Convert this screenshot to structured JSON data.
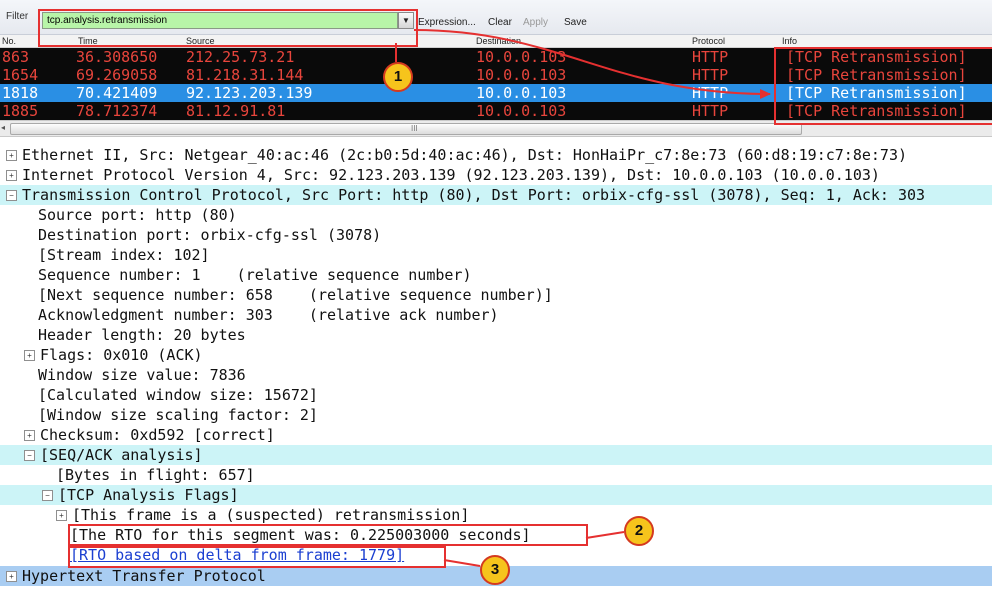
{
  "toolbar": {
    "filter_label": "Filter",
    "filter_value": "tcp.analysis.retransmission",
    "expression": "Expression...",
    "clear": "Clear",
    "apply": "Apply",
    "save": "Save"
  },
  "packet_list": {
    "columns": [
      "No.",
      "Time",
      "Source",
      "Destination",
      "Protocol",
      "Info"
    ],
    "rows": [
      {
        "no": "863",
        "time": "36.308650",
        "source": "212.25.73.21",
        "destination": "10.0.0.103",
        "protocol": "HTTP",
        "info": "[TCP Retransmission]"
      },
      {
        "no": "1654",
        "time": "69.269058",
        "source": "81.218.31.144",
        "destination": "10.0.0.103",
        "protocol": "HTTP",
        "info": "[TCP Retransmission]"
      },
      {
        "no": "1818",
        "time": "70.421409",
        "source": "92.123.203.139",
        "destination": "10.0.0.103",
        "protocol": "HTTP",
        "info": "[TCP Retransmission]"
      },
      {
        "no": "1885",
        "time": "78.712374",
        "source": "81.12.91.81",
        "destination": "10.0.0.103",
        "protocol": "HTTP",
        "info": "[TCP Retransmission]"
      }
    ],
    "scroll_grip": "III"
  },
  "details": [
    {
      "exp": "+",
      "text": "Ethernet II, Src: Netgear_40:ac:46 (2c:b0:5d:40:ac:46), Dst: HonHaiPr_c7:8e:73 (60:d8:19:c7:8e:73)"
    },
    {
      "exp": "+",
      "text": "Internet Protocol Version 4, Src: 92.123.203.139 (92.123.203.139), Dst: 10.0.0.103 (10.0.0.103)"
    },
    {
      "exp": "−",
      "text": "Transmission Control Protocol, Src Port: http (80), Dst Port: orbix-cfg-ssl (3078), Seq: 1, Ack: 303"
    },
    {
      "text": "Source port: http (80)"
    },
    {
      "text": "Destination port: orbix-cfg-ssl (3078)"
    },
    {
      "text": "[Stream index: 102]"
    },
    {
      "text": "Sequence number: 1    (relative sequence number)"
    },
    {
      "text": "[Next sequence number: 658    (relative sequence number)]"
    },
    {
      "text": "Acknowledgment number: 303    (relative ack number)"
    },
    {
      "text": "Header length: 20 bytes"
    },
    {
      "exp": "+",
      "text": "Flags: 0x010 (ACK)"
    },
    {
      "text": "Window size value: 7836"
    },
    {
      "text": "[Calculated window size: 15672]"
    },
    {
      "text": "[Window size scaling factor: 2]"
    },
    {
      "exp": "+",
      "text": "Checksum: 0xd592 [correct]"
    },
    {
      "exp": "−",
      "text": "[SEQ/ACK analysis]"
    },
    {
      "text": "[Bytes in flight: 657]"
    },
    {
      "exp": "−",
      "text": "[TCP Analysis Flags]"
    },
    {
      "exp": "+",
      "text": "[This frame is a (suspected) retransmission]"
    },
    {
      "text": "[The RTO for this segment was: 0.225003000 seconds]"
    },
    {
      "text": "[RTO based on delta from frame: 1779]"
    },
    {
      "exp": "+",
      "text": "Hypertext Transfer Protocol"
    }
  ],
  "callouts": [
    "1",
    "2",
    "3"
  ],
  "colors": {
    "annotation_red": "#e53030",
    "callout_fill": "#f6c41c",
    "filter_valid_green": "#b8f5a8",
    "selected_row": "#2a8fe4",
    "retransmission_text": "#e8453c",
    "highlight_cyan": "#ccf4f7"
  }
}
